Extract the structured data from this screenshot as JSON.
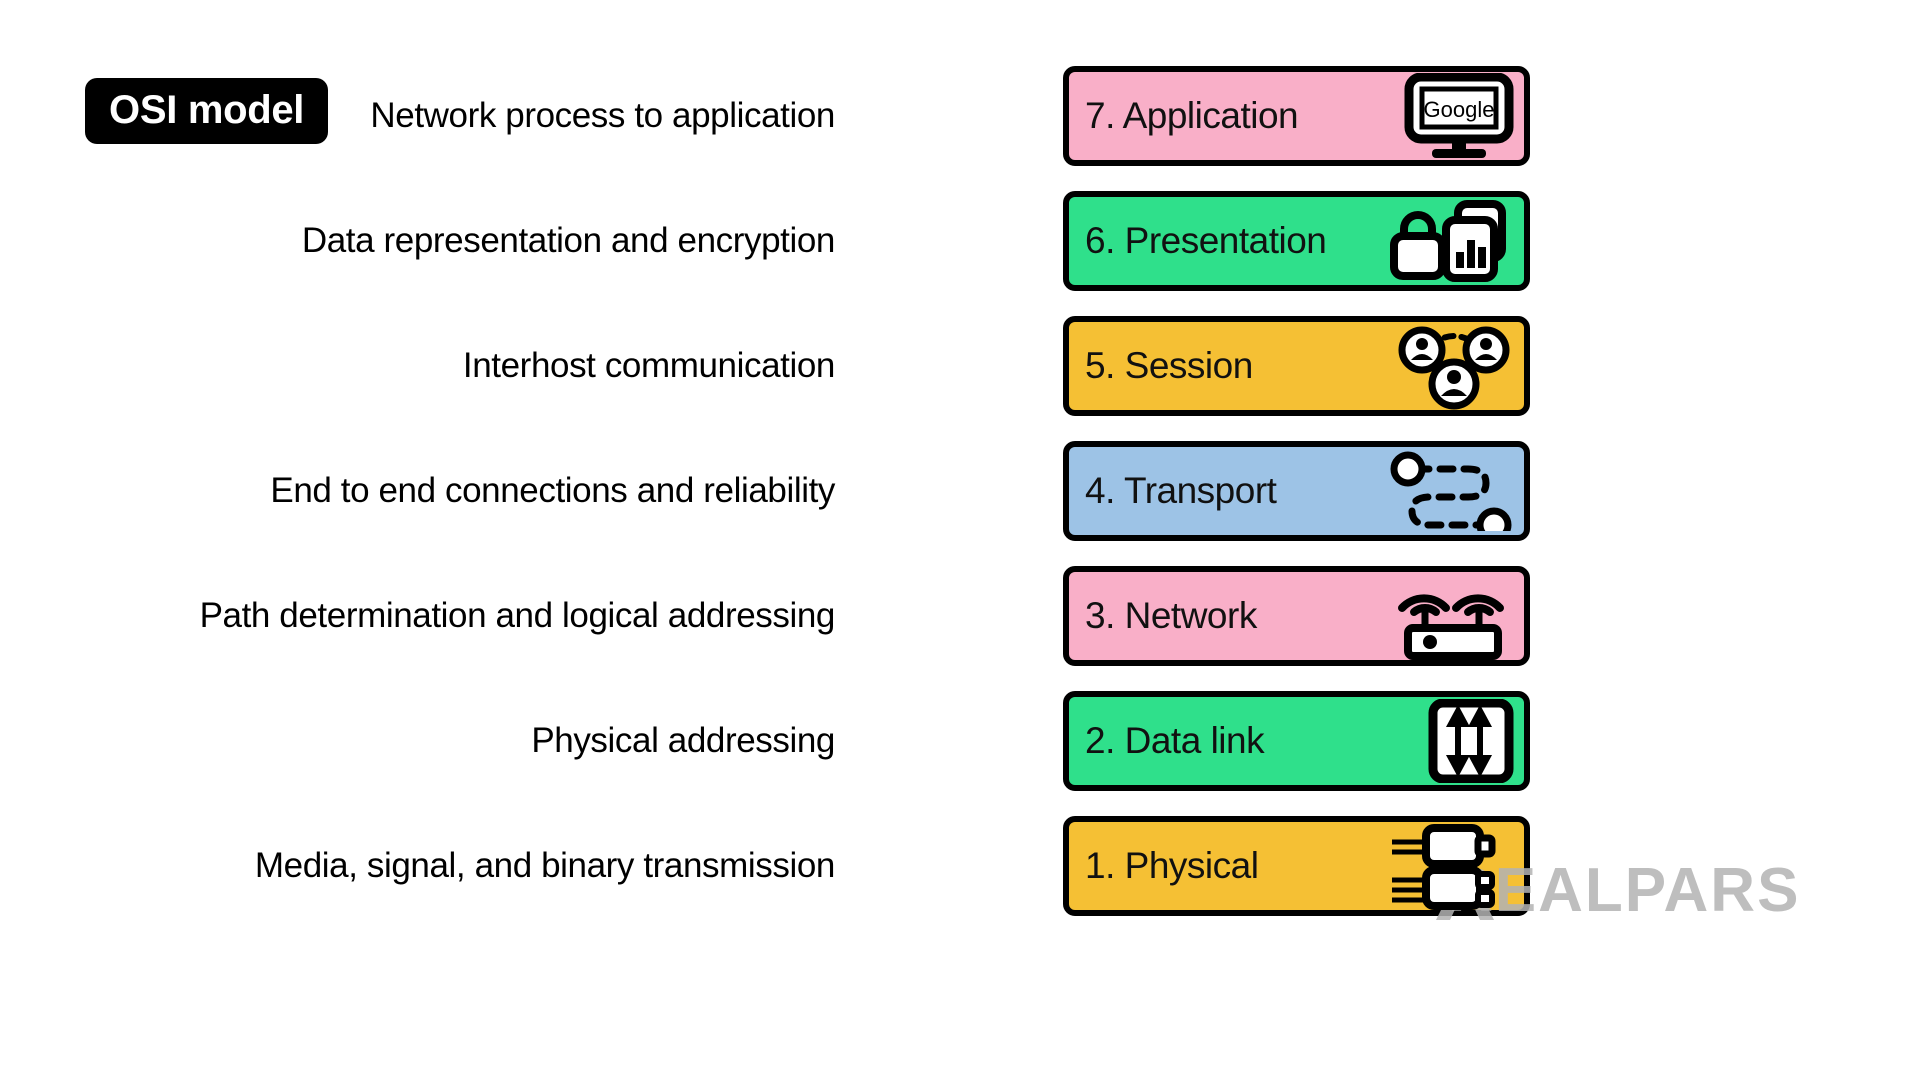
{
  "title": {
    "text": "OSI model"
  },
  "watermark": {
    "text": "REALPARS",
    "mark": "realpars-logo-mark"
  },
  "colors": {
    "pink": "#F9AFC8",
    "green": "#2FE08B",
    "amber": "#F5C034",
    "blue": "#9DC3E6",
    "outline": "#000000",
    "text": "#000000",
    "badge_bg": "#000000",
    "badge_text": "#FFFFFF",
    "watermark": "#B3B3B3",
    "background": "#FFFFFF"
  },
  "layers": [
    {
      "number": "7.",
      "name": "7. Application",
      "description": "Network process to application",
      "color": "#F9AFC8",
      "icon": "monitor-google-icon",
      "icon_label": "Google"
    },
    {
      "number": "6.",
      "name": "6. Presentation",
      "description": "Data representation and encryption",
      "color": "#2FE08B",
      "icon": "lock-and-documents-icon",
      "icon_label": ""
    },
    {
      "number": "5.",
      "name": "5. Session",
      "description": "Interhost communication",
      "color": "#F5C034",
      "icon": "three-users-connected-icon",
      "icon_label": ""
    },
    {
      "number": "4.",
      "name": "4. Transport",
      "description": "End to end connections and reliability",
      "color": "#9DC3E6",
      "icon": "dashed-route-endpoints-icon",
      "icon_label": ""
    },
    {
      "number": "3.",
      "name": "3. Network",
      "description": "Path determination and logical addressing",
      "color": "#F9AFC8",
      "icon": "wireless-router-icon",
      "icon_label": ""
    },
    {
      "number": "2.",
      "name": "2. Data link",
      "description": "Physical addressing",
      "color": "#2FE08B",
      "icon": "network-switch-arrows-icon",
      "icon_label": ""
    },
    {
      "number": "1.",
      "name": "1. Physical",
      "description": "Media, signal, and binary transmission",
      "color": "#F5C034",
      "icon": "cable-connectors-icon",
      "icon_label": ""
    }
  ]
}
